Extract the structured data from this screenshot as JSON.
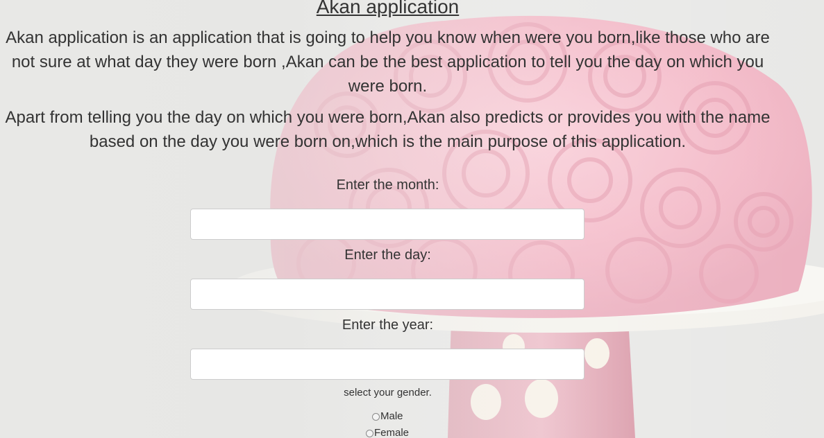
{
  "page": {
    "title": "Akan application",
    "intro_paragraph": "Akan application is an application that is going to help you know when were you born,like those who are not sure at what day they were born ,Akan can be the best application to tell you the day on which you were born.",
    "purpose_paragraph": "Apart from telling you the day on which you were born,Akan also predicts or provides you with the name based on the day you were born on,which is the main purpose of this application."
  },
  "form": {
    "month_label": "Enter the month:",
    "month_value": "",
    "day_label": "Enter the day:",
    "day_value": "",
    "year_label": "Enter the year:",
    "year_value": "",
    "gender_label": "select your gender.",
    "gender_options": [
      "Male",
      "Female"
    ]
  },
  "background": {
    "description_colors": {
      "base": "#e6e6e4",
      "frosting": "#f4b6c4",
      "stand": "#f0eee6"
    }
  }
}
